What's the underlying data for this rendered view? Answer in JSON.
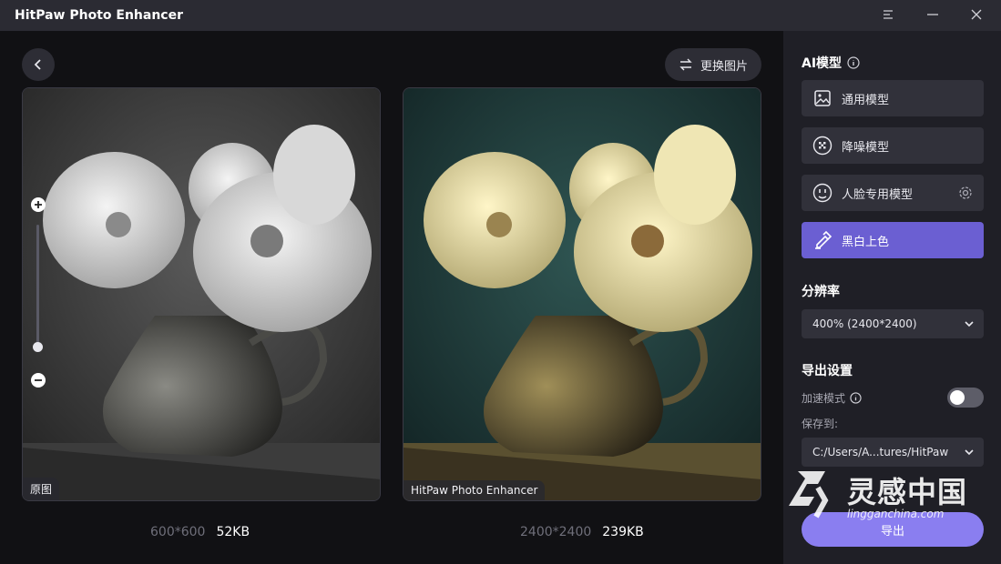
{
  "app": {
    "title": "HitPaw Photo Enhancer"
  },
  "toolbar": {
    "replace_label": "更换图片"
  },
  "left_image": {
    "tag": "原图",
    "dimensions": "600*600",
    "size": "52KB"
  },
  "right_image": {
    "tag": "HitPaw Photo Enhancer",
    "dimensions": "2400*2400",
    "size": "239KB"
  },
  "sidebar": {
    "ai_model_title": "AI模型",
    "models": [
      {
        "label": "通用模型",
        "icon": "image-icon"
      },
      {
        "label": "降噪模型",
        "icon": "denoise-icon"
      },
      {
        "label": "人脸专用模型",
        "icon": "face-icon"
      },
      {
        "label": "黑白上色",
        "icon": "colorize-icon"
      }
    ],
    "resolution_title": "分辨率",
    "resolution_value": "400% (2400*2400)",
    "export_title": "导出设置",
    "accelerate_label": "加速模式",
    "save_to_label": "保存到:",
    "save_path": "C:/Users/A...tures/HitPaw",
    "export_label": "导出"
  },
  "watermark": {
    "text": "灵感中国",
    "url": "lingganchina.com"
  },
  "colors": {
    "accent": "#6b5fd2",
    "export": "#8a7ef0",
    "panel": "#1f1f26"
  }
}
